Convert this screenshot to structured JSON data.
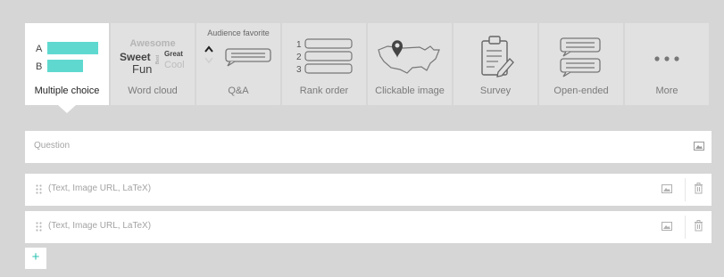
{
  "tabs": [
    {
      "label": "Multiple choice",
      "active": true
    },
    {
      "label": "Word cloud",
      "active": false
    },
    {
      "label": "Q&A",
      "active": false
    },
    {
      "label": "Rank order",
      "active": false
    },
    {
      "label": "Clickable image",
      "active": false
    },
    {
      "label": "Survey",
      "active": false
    },
    {
      "label": "Open-ended",
      "active": false
    },
    {
      "label": "More",
      "active": false
    }
  ],
  "mc_preview": {
    "option_a": "A",
    "option_b": "B",
    "bar_color": "#5fd9d0"
  },
  "word_cloud_preview": {
    "words": [
      "Awesome",
      "Sweet",
      "Great",
      "Best",
      "Fun",
      "Cool"
    ]
  },
  "qa_preview": {
    "caption": "Audience favorite"
  },
  "rank_preview": {
    "numbers": [
      "1",
      "2",
      "3"
    ]
  },
  "question_field": {
    "placeholder": "Question"
  },
  "options": [
    {
      "placeholder": "(Text, Image URL, LaTeX)"
    },
    {
      "placeholder": "(Text, Image URL, LaTeX)"
    }
  ],
  "add_button": {
    "label": "+"
  },
  "colors": {
    "accent": "#2bc2b0",
    "background": "#d6d6d6",
    "tab_inactive": "#e1e1e1"
  }
}
